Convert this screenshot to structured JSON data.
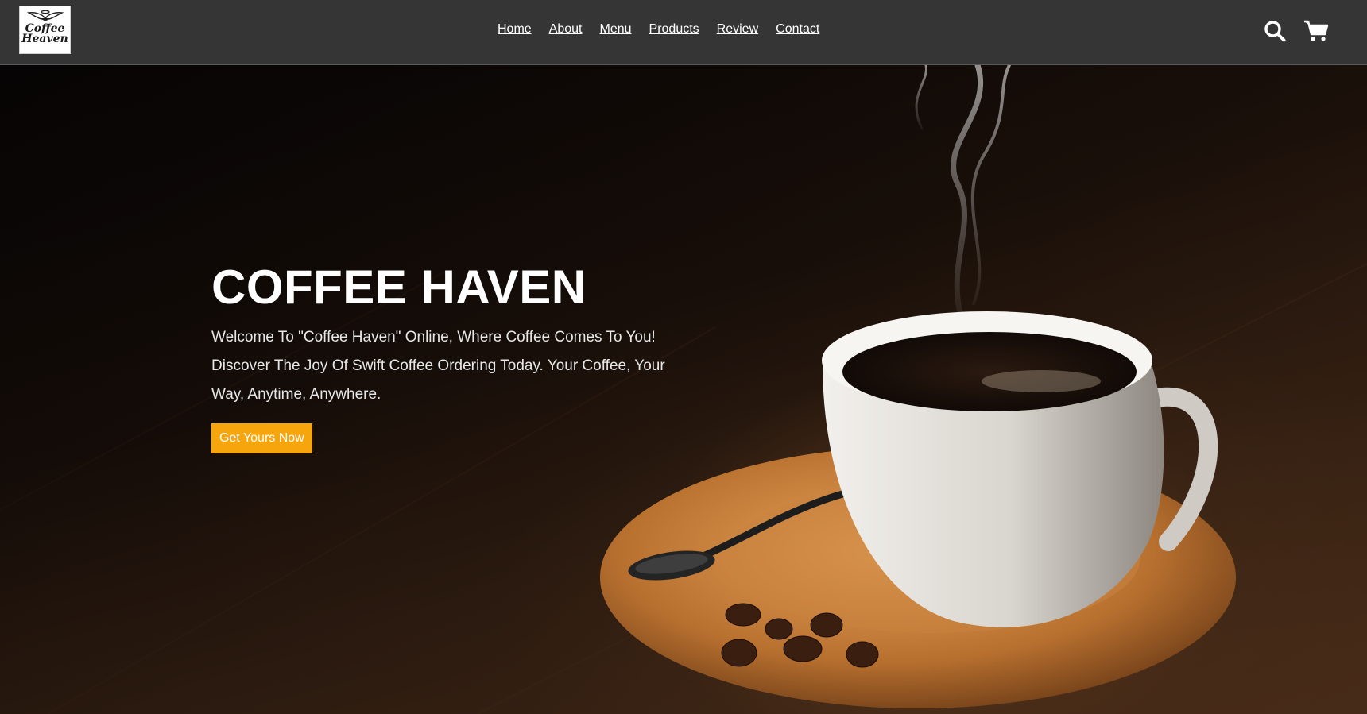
{
  "brand": {
    "logo_text_line1": "Coffee",
    "logo_text_line2": "Heaven"
  },
  "nav": {
    "links": [
      "Home",
      "About",
      "Menu",
      "Products",
      "Review",
      "Contact"
    ]
  },
  "icons": {
    "search": "search-icon",
    "cart": "cart-icon"
  },
  "hero": {
    "title": "COFFEE HAVEN",
    "description": "Welcome To \"Coffee Haven\" Online, Where Coffee Comes To You! Discover The Joy Of Swift Coffee Ordering Today. Your Coffee, Your Way, Anytime, Anywhere.",
    "cta_label": "Get Yours Now"
  },
  "colors": {
    "navbar_bg": "#353535",
    "accent": "#f6a50d",
    "text_light": "#ffffff"
  }
}
